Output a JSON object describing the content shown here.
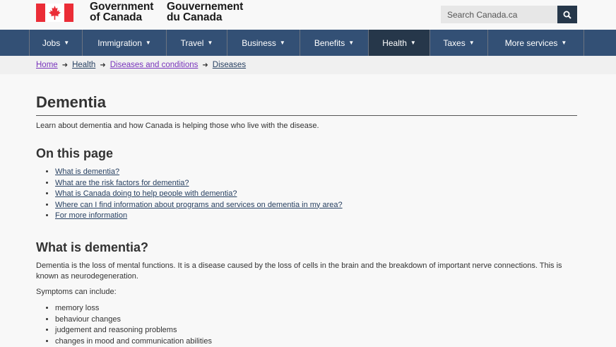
{
  "header": {
    "brand_en_line1": "Government",
    "brand_en_line2": "of Canada",
    "brand_fr_line1": "Gouvernement",
    "brand_fr_line2": "du Canada",
    "search_placeholder": "Search Canada.ca"
  },
  "menu": {
    "items": [
      {
        "label": "Jobs"
      },
      {
        "label": "Immigration"
      },
      {
        "label": "Travel"
      },
      {
        "label": "Business"
      },
      {
        "label": "Benefits"
      },
      {
        "label": "Health"
      },
      {
        "label": "Taxes"
      },
      {
        "label": "More services"
      }
    ],
    "chevron": "▼"
  },
  "breadcrumb": {
    "items": [
      "Home",
      "Health",
      "Diseases and conditions",
      "Diseases"
    ]
  },
  "page": {
    "title": "Dementia",
    "intro": "Learn about dementia and how Canada is helping those who live with the disease.",
    "toc_heading": "On this page",
    "toc": [
      "What is dementia?",
      "What are the risk factors for dementia?",
      "What is Canada doing to help people with dementia?",
      "Where can I find information about programs and services on dementia in my area?",
      "For more information"
    ],
    "section_heading": "What is dementia?",
    "section_para": "Dementia is the loss of mental functions. It is a disease caused by the loss of cells in the brain and the breakdown of important nerve connections. This is known as neurodegeneration.",
    "symptoms_intro": "Symptoms can include:",
    "symptoms": [
      "memory loss",
      "behaviour changes",
      "judgement and reasoning problems",
      "changes in mood and communication abilities"
    ]
  },
  "colors": {
    "flag_red": "#eb2d37",
    "menu_bg": "#335075",
    "menu_active": "#26374a",
    "link": "#284162",
    "visited": "#7834bc"
  }
}
